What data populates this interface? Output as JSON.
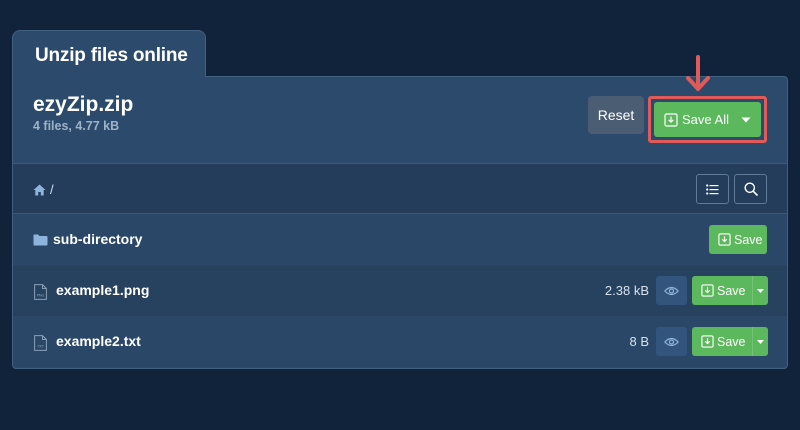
{
  "tab": {
    "title": "Unzip files online"
  },
  "archive": {
    "name": "ezyZip.zip",
    "meta": "4 files, 4.77 kB"
  },
  "header": {
    "reset_label": "Reset",
    "save_all_label": "Save All"
  },
  "breadcrumb": {
    "separator": "/"
  },
  "files": [
    {
      "name": "sub-directory",
      "type": "folder",
      "size": "",
      "save_label": "Save"
    },
    {
      "name": "example1.png",
      "type": "file",
      "ext": "PNG",
      "size": "2.38 kB",
      "save_label": "Save"
    },
    {
      "name": "example2.txt",
      "type": "file",
      "ext": "TXT",
      "size": "8 B",
      "save_label": "Save"
    }
  ],
  "colors": {
    "background": "#11233a",
    "panel": "#2c4a6c",
    "save_green": "#5cb85c",
    "reset_gray": "#4a5d72",
    "highlight_red": "#e05a5a"
  }
}
